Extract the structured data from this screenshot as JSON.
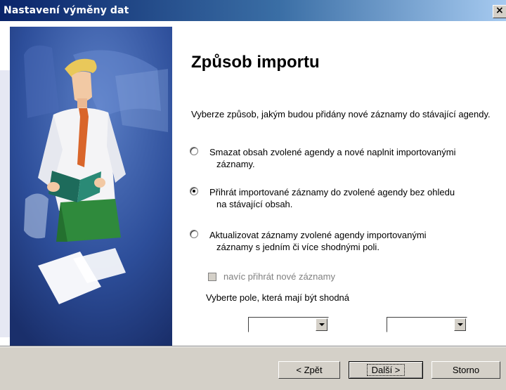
{
  "window": {
    "title": "Nastavení výměny dat",
    "close_glyph": "×"
  },
  "page": {
    "heading": "Způsob importu",
    "description": "Vyberze způsob, jakým budou přidány nové záznamy do stávající agendy.",
    "options": [
      {
        "line1": "Smazat obsah zvolené agendy a nové naplnit importovanými",
        "line2": "záznamy.",
        "checked": false
      },
      {
        "line1": "Přihrát importované záznamy do zvolené agendy bez ohledu",
        "line2": "na stávající obsah.",
        "checked": true
      },
      {
        "line1": "Aktualizovat záznamy zvolené agendy importovanými",
        "line2": "záznamy s jedním či více shodnými poli.",
        "checked": false
      }
    ],
    "checkbox_label": "navíc přihrát nové záznamy",
    "match_label": "Vyberte pole, která mají být shodná",
    "combo1_value": "",
    "combo2_value": ""
  },
  "buttons": {
    "back": "< Zpět",
    "next": "Další >",
    "cancel": "Storno"
  },
  "colors": {
    "title_gradient_start": "#0a246a",
    "title_gradient_end": "#a6caf0",
    "dialog_face": "#d4d0c8",
    "illustration_bg": "#2d4e9a"
  }
}
